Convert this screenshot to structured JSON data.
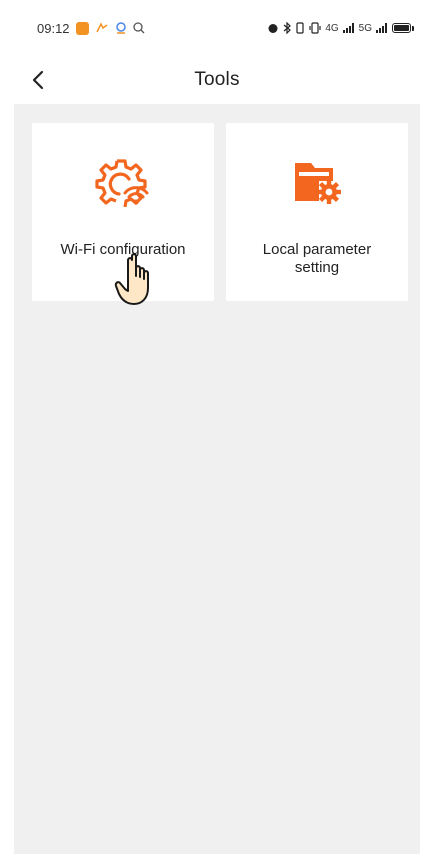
{
  "status_bar": {
    "time": "09:12",
    "network_1": "4G",
    "network_2": "5G"
  },
  "header": {
    "title": "Tools",
    "back_icon": "chevron-left-icon"
  },
  "tiles": [
    {
      "label": "Wi-Fi configuration",
      "icon": "gear-wifi-icon"
    },
    {
      "label": "Local parameter setting",
      "icon": "folder-gear-icon"
    }
  ],
  "colors": {
    "accent": "#f2661f",
    "background": "#f0f0f0",
    "tile": "#ffffff"
  }
}
